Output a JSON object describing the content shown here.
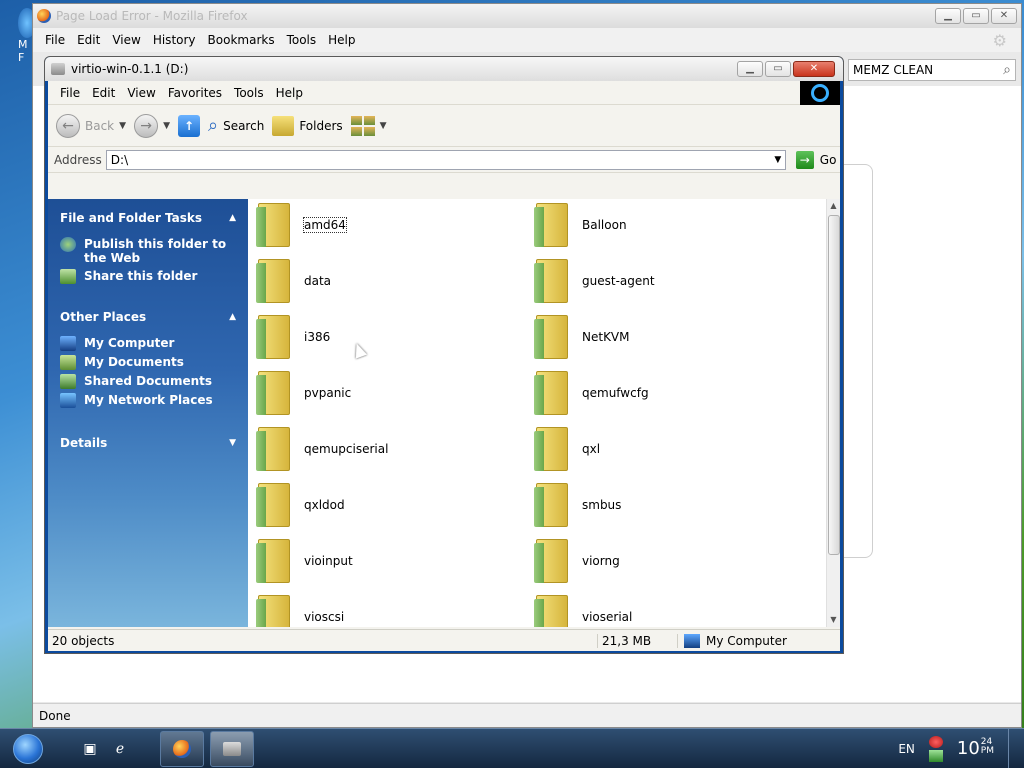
{
  "desktop": {
    "peek_label_1": "M",
    "peek_label_2": "F"
  },
  "firefox": {
    "title": "Page Load Error - Mozilla Firefox",
    "menu": [
      "File",
      "Edit",
      "View",
      "History",
      "Bookmarks",
      "Tools",
      "Help"
    ],
    "search_value": "MEMZ CLEAN",
    "status": "Done"
  },
  "explorer": {
    "title": "virtio-win-0.1.1 (D:)",
    "menu": [
      "File",
      "Edit",
      "View",
      "Favorites",
      "Tools",
      "Help"
    ],
    "toolbar": {
      "back": "Back",
      "search": "Search",
      "folders": "Folders"
    },
    "address_label": "Address",
    "address_value": "D:\\",
    "go_label": "Go",
    "side": {
      "tasks_header": "File and Folder Tasks",
      "tasks": [
        "Publish this folder to the Web",
        "Share this folder"
      ],
      "other_header": "Other Places",
      "other": [
        "My Computer",
        "My Documents",
        "Shared Documents",
        "My Network Places"
      ],
      "details_header": "Details"
    },
    "folders": [
      "amd64",
      "Balloon",
      "data",
      "guest-agent",
      "i386",
      "NetKVM",
      "pvpanic",
      "qemufwcfg",
      "qemupciserial",
      "qxl",
      "qxldod",
      "smbus",
      "vioinput",
      "viorng",
      "vioscsi",
      "vioserial"
    ],
    "status": {
      "count": "20 objects",
      "size": "21,3 MB",
      "location": "My Computer"
    }
  },
  "taskbar": {
    "lang": "EN",
    "clock_hours": "10",
    "clock_min": "24",
    "clock_ampm": "PM"
  }
}
